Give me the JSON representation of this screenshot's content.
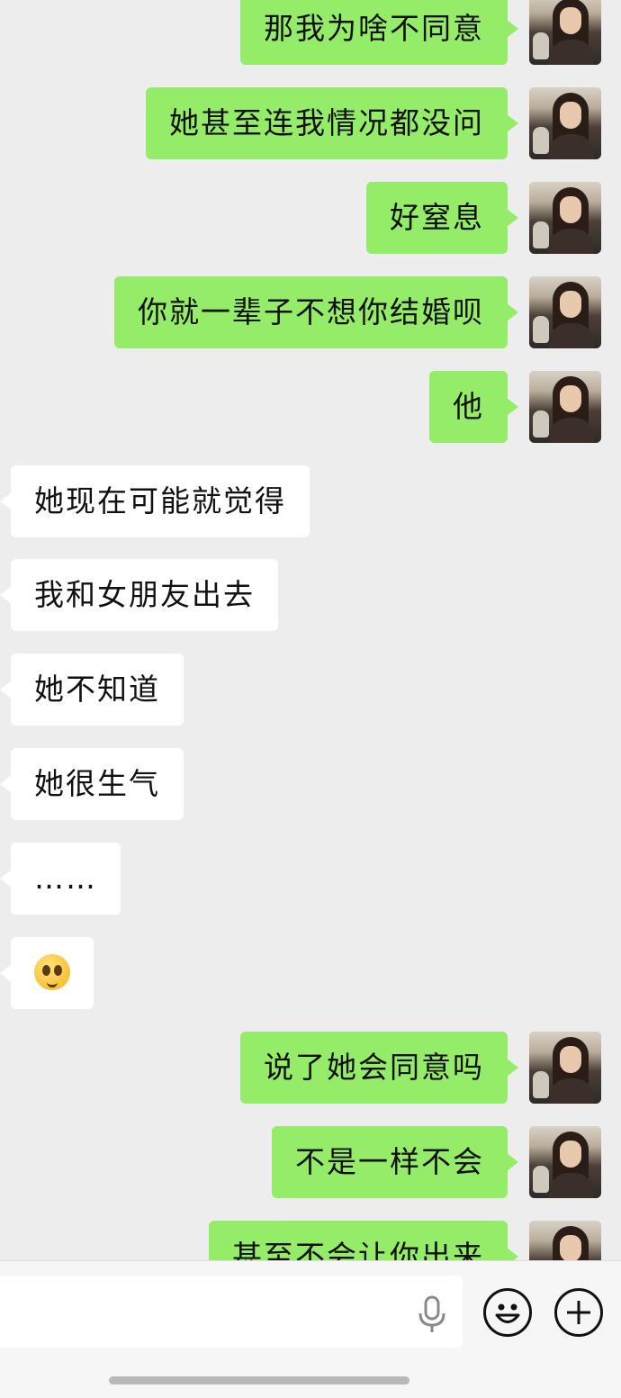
{
  "messages": [
    {
      "side": "sent",
      "text": "那我为啥不同意"
    },
    {
      "side": "sent",
      "text": "她甚至连我情况都没问"
    },
    {
      "side": "sent",
      "text": "好窒息"
    },
    {
      "side": "sent",
      "text": "你就一辈子不想你结婚呗"
    },
    {
      "side": "sent",
      "text": "他"
    },
    {
      "side": "recv",
      "text": "她现在可能就觉得"
    },
    {
      "side": "recv",
      "text": "我和女朋友出去"
    },
    {
      "side": "recv",
      "text": "她不知道"
    },
    {
      "side": "recv",
      "text": "她很生气"
    },
    {
      "side": "recv",
      "text": "……"
    },
    {
      "side": "recv",
      "emoji": "drooling-face-emoji"
    },
    {
      "side": "sent",
      "text": "说了她会同意吗"
    },
    {
      "side": "sent",
      "text": "不是一样不会"
    },
    {
      "side": "sent",
      "text": "甚至不会让你出来"
    }
  ],
  "input_bar": {
    "text_value": "",
    "voice_icon": "microphone-icon",
    "emoji_icon": "smiley-face-icon",
    "more_icon": "plus-circle-icon"
  },
  "colors": {
    "background": "#ededed",
    "sent_bubble": "#95ec69",
    "received_bubble": "#ffffff"
  }
}
